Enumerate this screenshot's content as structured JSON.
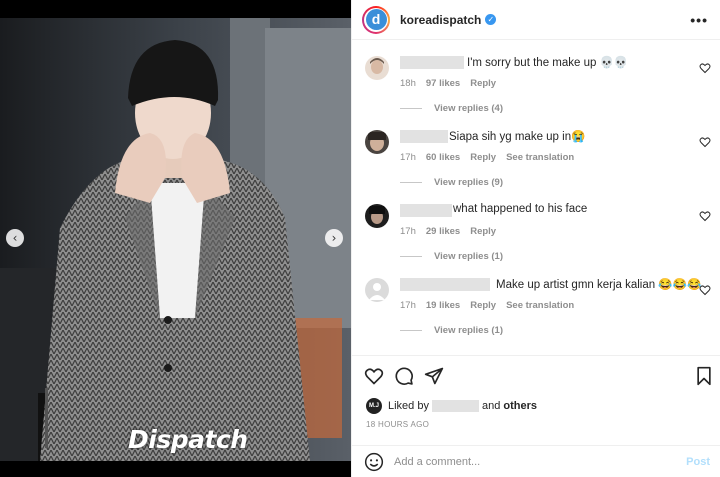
{
  "post": {
    "username": "koreadispatch",
    "avatar_letter": "d",
    "more_label": "•••",
    "watermark": "Dispatch",
    "nav_prev": "‹",
    "nav_next": "›"
  },
  "comments": [
    {
      "text": "I'm sorry but the make up 💀💀",
      "time": "18h",
      "likes": "97 likes",
      "reply": "Reply",
      "translate": "",
      "view_replies": "View replies (4)"
    },
    {
      "text": "Siapa sih yg make up in😭",
      "time": "17h",
      "likes": "60 likes",
      "reply": "Reply",
      "translate": "See translation",
      "view_replies": "View replies (9)"
    },
    {
      "text": "what happened to his face",
      "time": "17h",
      "likes": "29 likes",
      "reply": "Reply",
      "translate": "",
      "view_replies": "View replies (1)"
    },
    {
      "text": "Make up artist gmn kerja kalian 😂😂😂",
      "time": "17h",
      "likes": "19 likes",
      "reply": "Reply",
      "translate": "See translation",
      "view_replies": "View replies (1)"
    }
  ],
  "likes": {
    "badge": "M.J",
    "prefix": "Liked by",
    "middle": "and",
    "suffix": "others"
  },
  "timestamp": "18 HOURS AGO",
  "add_comment": {
    "placeholder": "Add a comment...",
    "post_label": "Post"
  },
  "colors": {
    "verified": "#3897f0",
    "post_disabled": "#b2dffc",
    "meta": "#8e8e8e"
  }
}
